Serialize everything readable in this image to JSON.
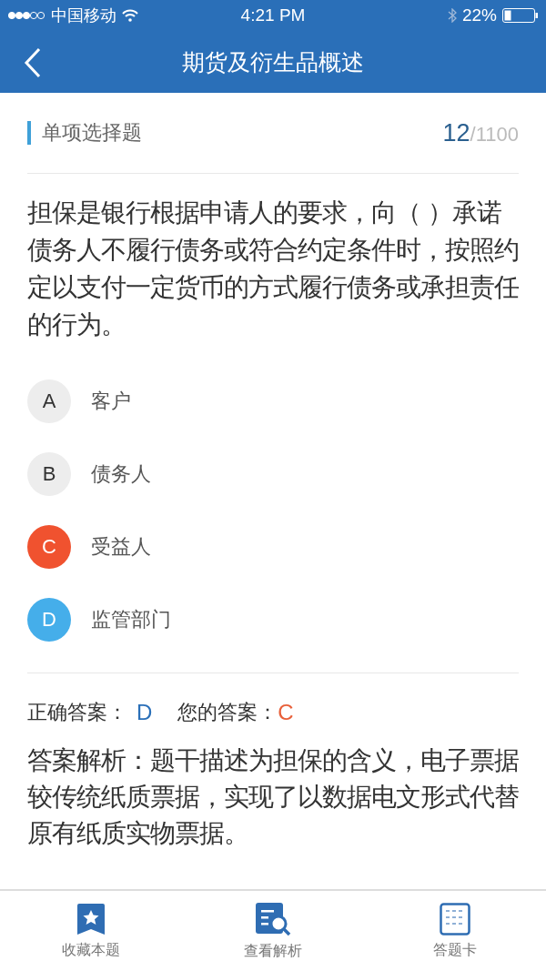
{
  "status_bar": {
    "carrier": "中国移动",
    "time": "4:21 PM",
    "battery": "22%"
  },
  "nav": {
    "title": "期货及衍生品概述"
  },
  "question": {
    "type": "单项选择题",
    "index": "12",
    "total": "/1100",
    "text": "担保是银行根据申请人的要求，向（  ）承诺债务人不履行债务或符合约定条件时，按照约定以支付一定货币的方式履行债务或承担责任的行为。"
  },
  "options": [
    {
      "letter": "A",
      "text": "客户",
      "selected": false,
      "correct": false
    },
    {
      "letter": "B",
      "text": "债务人",
      "selected": false,
      "correct": false
    },
    {
      "letter": "C",
      "text": "受益人",
      "selected": true,
      "correct": false
    },
    {
      "letter": "D",
      "text": "监管部门",
      "selected": false,
      "correct": true
    }
  ],
  "answer": {
    "correct_label": "正确答案：",
    "correct": "D",
    "yours_label": "您的答案：",
    "yours": "C",
    "explanation": "答案解析：题干描述为担保的含义，电子票据较传统纸质票据，实现了以数据电文形式代替原有纸质实物票据。"
  },
  "tab_bar": [
    {
      "kind": "favorite",
      "label": "收藏本题"
    },
    {
      "kind": "analysis",
      "label": "查看解析"
    },
    {
      "kind": "card",
      "label": "答题卡"
    }
  ]
}
